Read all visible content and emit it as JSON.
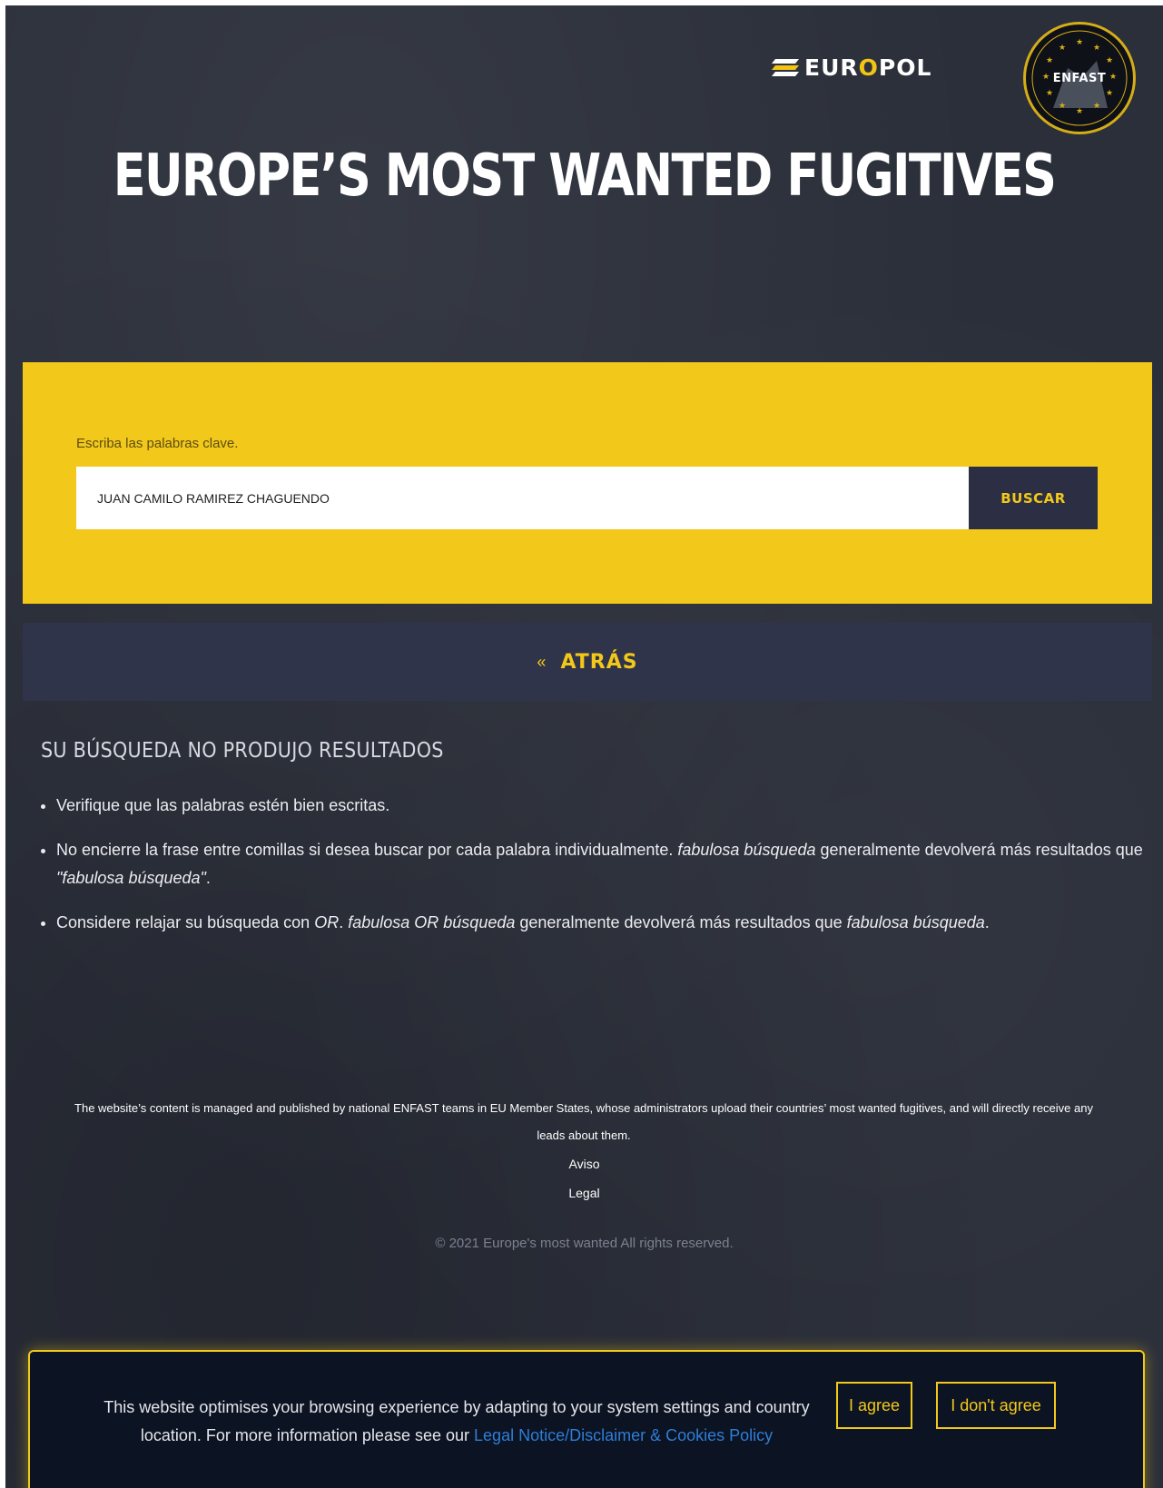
{
  "header": {
    "europol_logo": {
      "word_before": "EUR",
      "word_accent": "O",
      "word_after": "POL"
    },
    "enfast_logo": {
      "text": "ENFAST"
    },
    "title": "EUROPE’S MOST WANTED FUGITIVES"
  },
  "search": {
    "label": "Escriba las palabras clave.",
    "value": "JUAN CAMILO RAMIREZ CHAGUENDO",
    "button_label": "BUSCAR"
  },
  "back": {
    "arrow": "«",
    "label": "ATRÁS"
  },
  "results": {
    "heading": "SU BÚSQUEDA NO PRODUJO RESULTADOS",
    "tip1": "Verifique que las palabras estén bien escritas.",
    "tip2": {
      "part1": "No encierre la frase entre comillas si desea buscar por cada palabra individualmente.",
      "em1": "fabulosa búsqueda",
      "part2": "generalmente devolverá más resultados que",
      "em2": "\"fabulosa búsqueda\"",
      "end": "."
    },
    "tip3": {
      "part1": "Considere relajar su búsqueda con",
      "em1": "OR",
      "part2": ".",
      "em2": "fabulosa OR búsqueda",
      "part3": "generalmente devolverá más resultados que",
      "em3": "fabulosa búsqueda",
      "end": "."
    }
  },
  "footer": {
    "note": "The website’s content is managed and published by national ENFAST teams in EU Member States, whose administrators upload their countries’ most wanted fugitives, and will directly receive any leads about them.",
    "link1": "Aviso",
    "link2": "Legal",
    "copyright": "© 2021 Europe's most wanted All rights reserved."
  },
  "cookie": {
    "text": "This website optimises your browsing experience by adapting to your system settings and country location. For more information please see our",
    "link": "Legal Notice/Disclaimer & Cookies Policy",
    "agree": "I agree",
    "disagree": "I don't agree"
  },
  "colors": {
    "background": "#2b2f3a",
    "accent_yellow": "#f2c81a",
    "dark_button": "#2c2f43",
    "link_blue": "#2d7ed8"
  }
}
